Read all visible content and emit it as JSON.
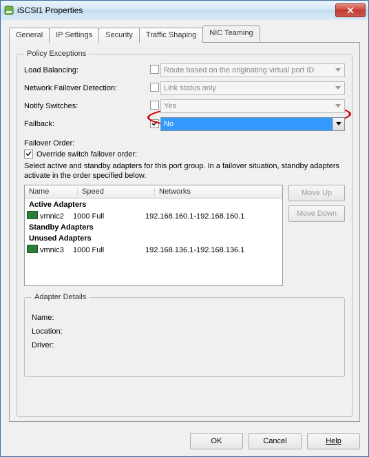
{
  "window": {
    "title": "iSCSI1 Properties"
  },
  "tabs": {
    "general": "General",
    "ip": "IP Settings",
    "security": "Security",
    "traffic": "Traffic Shaping",
    "nic": "NIC Teaming"
  },
  "policy": {
    "legend": "Policy Exceptions",
    "load_balancing": {
      "label": "Load Balancing:",
      "checked": false,
      "value": "Route based on the originating virtual port ID"
    },
    "failover_detection": {
      "label": "Network Failover Detection:",
      "checked": false,
      "value": "Link status only"
    },
    "notify_switches": {
      "label": "Notify Switches:",
      "checked": false,
      "value": "Yes"
    },
    "failback": {
      "label": "Failback:",
      "checked": true,
      "value": "No"
    }
  },
  "failover": {
    "order_label": "Failover Order:",
    "override_label": "Override switch failover order:",
    "override_checked": true,
    "description": "Select active and standby adapters for this port group.  In a failover situation, standby adapters activate  in the order specified below."
  },
  "list": {
    "headers": {
      "name": "Name",
      "speed": "Speed",
      "networks": "Networks"
    },
    "groups": {
      "active": "Active Adapters",
      "standby": "Standby Adapters",
      "unused": "Unused Adapters"
    },
    "active": [
      {
        "name": "vmnic2",
        "speed": "1000 Full",
        "networks": "192.168.160.1-192.168.160.1"
      }
    ],
    "standby": [],
    "unused": [
      {
        "name": "vmnic3",
        "speed": "1000 Full",
        "networks": "192.168.136.1-192.168.136.1"
      }
    ]
  },
  "side_buttons": {
    "move_up": "Move Up",
    "move_down": "Move Down"
  },
  "details": {
    "legend": "Adapter Details",
    "name_label": "Name:",
    "location_label": "Location:",
    "driver_label": "Driver:"
  },
  "buttons": {
    "ok": "OK",
    "cancel": "Cancel",
    "help": "Help"
  }
}
